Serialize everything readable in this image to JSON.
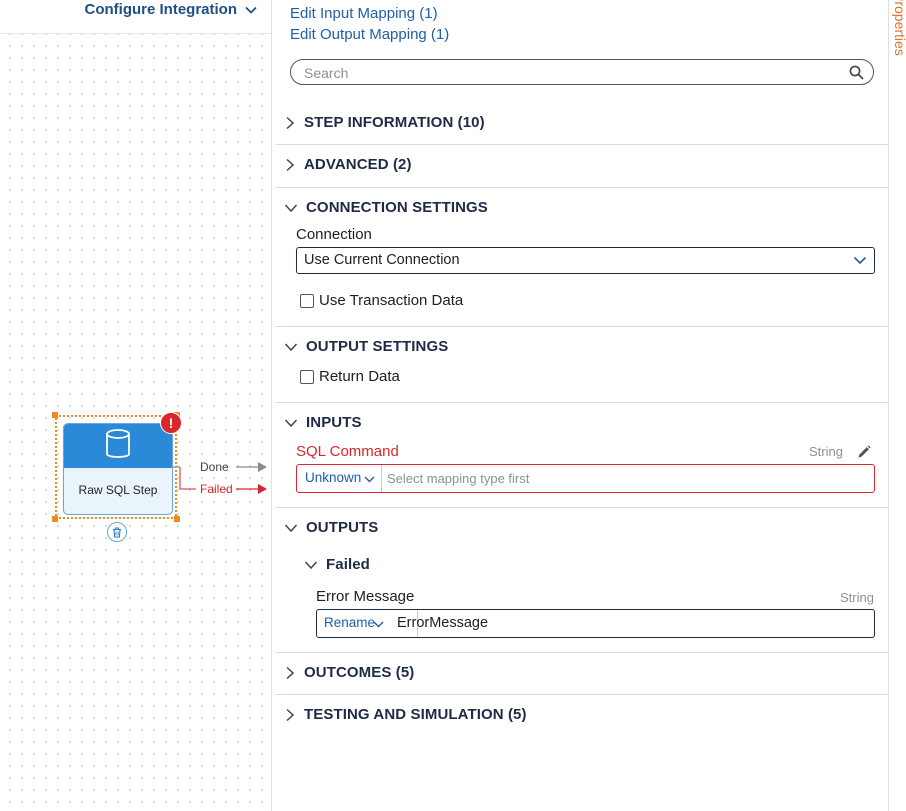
{
  "canvas": {
    "configure_label": "Configure Integration",
    "node": {
      "label": "Raw SQL Step",
      "error_badge": "!",
      "outcomes": [
        "Done",
        "Failed"
      ]
    }
  },
  "panel": {
    "links": {
      "edit_input": "Edit Input Mapping (1)",
      "edit_output": "Edit Output Mapping (1)"
    },
    "search": {
      "placeholder": "Search",
      "value": ""
    },
    "sections": {
      "step_info": "STEP INFORMATION (10)",
      "advanced": "ADVANCED (2)",
      "connection": "CONNECTION SETTINGS",
      "output_settings": "OUTPUT SETTINGS",
      "inputs": "INPUTS",
      "outputs": "OUTPUTS",
      "outcomes": "OUTCOMES (5)",
      "testing": "TESTING AND SIMULATION (5)"
    },
    "connection": {
      "label": "Connection",
      "value": "Use Current Connection",
      "use_transaction_label": "Use Transaction Data",
      "use_transaction_checked": false
    },
    "output_settings": {
      "return_data_label": "Return Data",
      "return_data_checked": false
    },
    "inputs": {
      "sql_label": "SQL Command",
      "sql_type": "String",
      "mapping_type": "Unknown",
      "mapping_placeholder": "Select mapping type first"
    },
    "outputs": {
      "group": "Failed",
      "error_label": "Error Message",
      "error_type": "String",
      "mapping_type": "Rename",
      "error_value": "ErrorMessage"
    }
  },
  "right_tab": "Properties",
  "colors": {
    "accent_link": "#1e5fa8",
    "error": "#d9262c",
    "node_blue": "#2b8ad8",
    "selection": "#f08a1c",
    "properties_tab": "#e0722a"
  }
}
